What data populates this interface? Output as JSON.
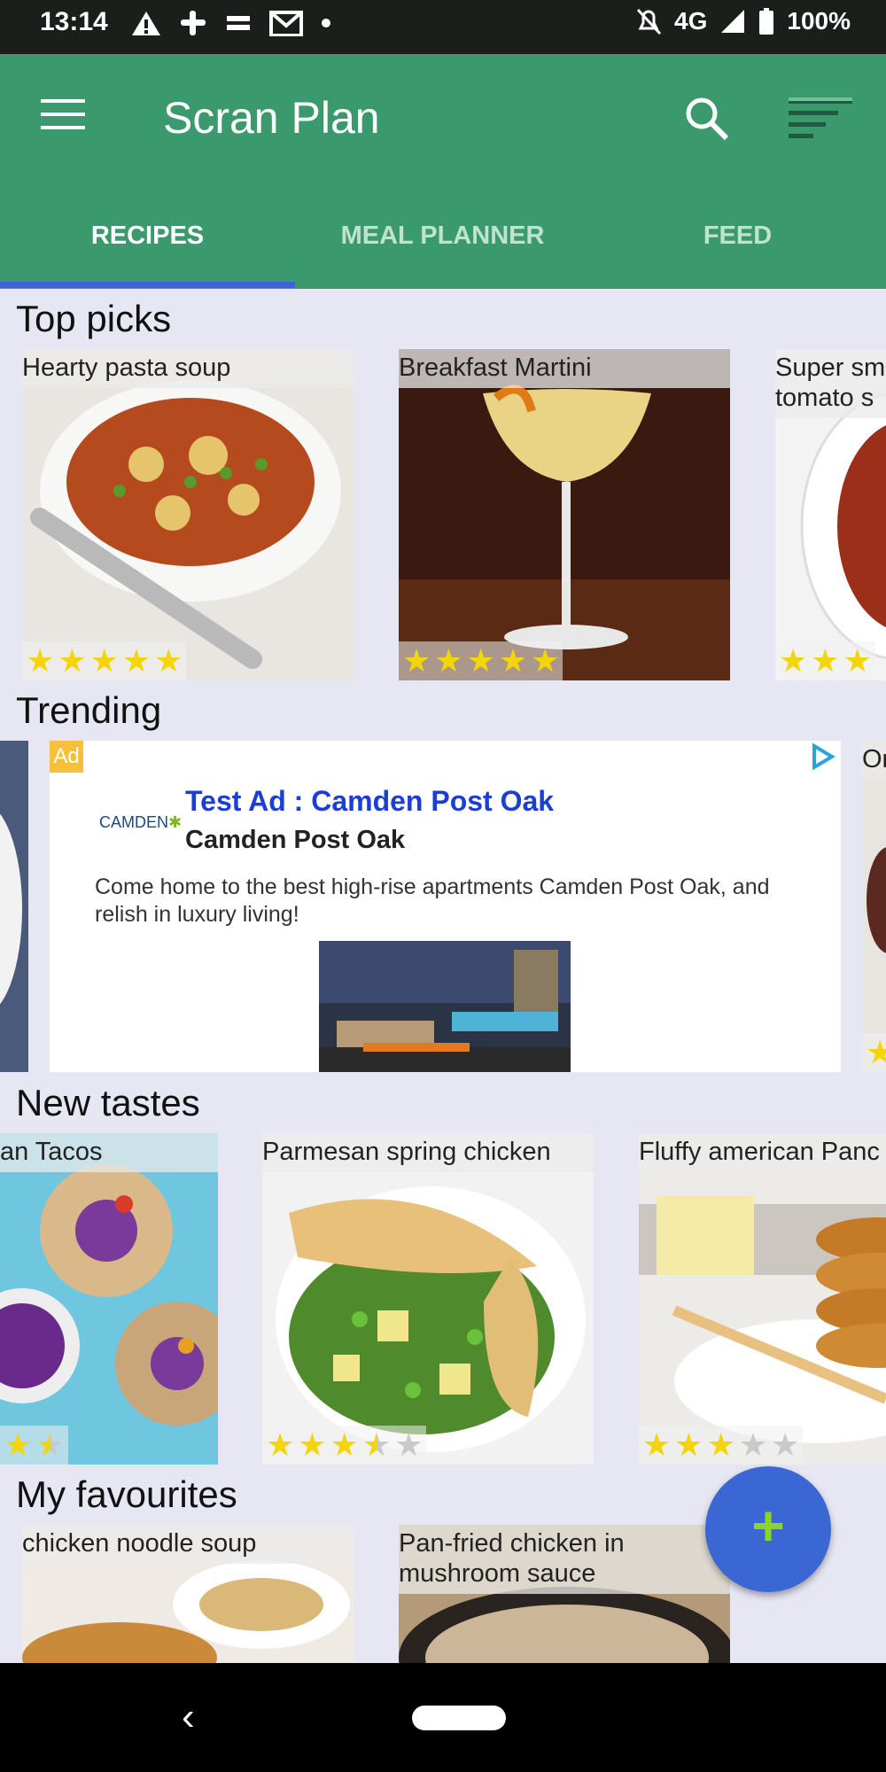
{
  "status_bar": {
    "time": "13:14",
    "network": "4G",
    "battery": "100%"
  },
  "app_bar": {
    "title": "Scran Plan"
  },
  "tabs": [
    {
      "label": "RECIPES",
      "active": true
    },
    {
      "label": "MEAL PLANNER",
      "active": false
    },
    {
      "label": "FEED",
      "active": false
    }
  ],
  "sections": {
    "top_picks": {
      "title": "Top picks",
      "cards": [
        {
          "title": "Hearty pasta soup",
          "rating": 5
        },
        {
          "title": "Breakfast Martini",
          "rating": 5
        },
        {
          "title": "Super sm tomato s",
          "rating": 3
        }
      ]
    },
    "trending": {
      "title": "Trending",
      "next_card_label": "Or",
      "ad": {
        "badge": "Ad",
        "logo_text": "CAMDEN",
        "headline": "Test Ad : Camden Post Oak",
        "advertiser": "Camden Post Oak",
        "body": "Come home to the best high-rise apartments Camden Post Oak, and relish in luxury living!"
      }
    },
    "new_tastes": {
      "title": "New tastes",
      "cards": [
        {
          "title": "an Tacos",
          "rating": 1.5
        },
        {
          "title": "Parmesan spring chicken",
          "rating": 3.5
        },
        {
          "title": "Fluffy american Panc",
          "rating": 3
        }
      ]
    },
    "my_favourites": {
      "title": "My favourites",
      "cards": [
        {
          "title": "chicken noodle soup"
        },
        {
          "title": "Pan-fried chicken in mushroom sauce"
        }
      ]
    }
  },
  "fab": {
    "label": "+"
  },
  "nav_bar": {
    "back": "‹"
  },
  "colors": {
    "primary": "#3a9a6d",
    "accent": "#3a67d4",
    "star": "#f3d50a"
  }
}
